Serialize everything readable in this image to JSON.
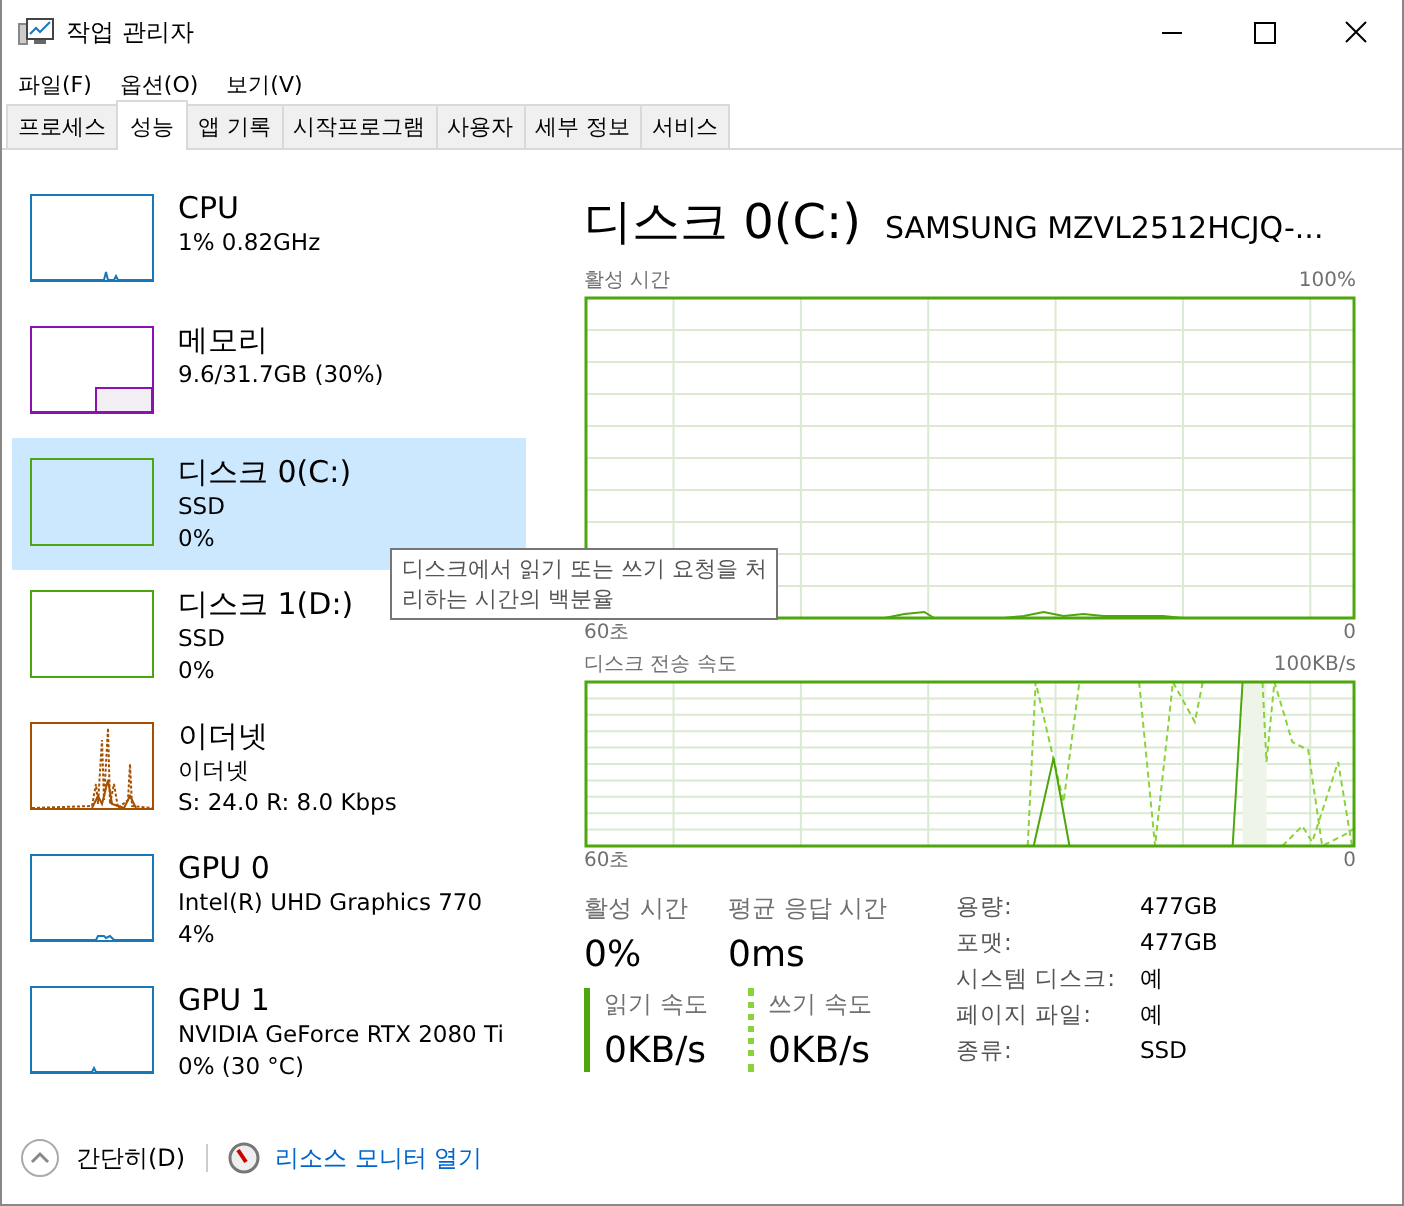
{
  "window": {
    "title": "작업 관리자"
  },
  "menu": [
    "파일(F)",
    "옵션(O)",
    "보기(V)"
  ],
  "tabs": [
    {
      "label": "프로세스",
      "selected": false
    },
    {
      "label": "성능",
      "selected": true
    },
    {
      "label": "앱 기록",
      "selected": false
    },
    {
      "label": "시작프로그램",
      "selected": false
    },
    {
      "label": "사용자",
      "selected": false
    },
    {
      "label": "세부 정보",
      "selected": false
    },
    {
      "label": "서비스",
      "selected": false
    }
  ],
  "sidebar": {
    "items": [
      {
        "kind": "cpu",
        "color": "#1779ba",
        "title": "CPU",
        "lines": [
          "1% 0.82GHz"
        ],
        "selected": false
      },
      {
        "kind": "memory",
        "color": "#8b12ae",
        "title": "메모리",
        "lines": [
          "9.6/31.7GB (30%)"
        ],
        "selected": false
      },
      {
        "kind": "disk",
        "color": "#4da60c",
        "title": "디스크 0(C:)",
        "lines": [
          "SSD",
          "0%"
        ],
        "selected": true
      },
      {
        "kind": "disk",
        "color": "#4da60c",
        "title": "디스크 1(D:)",
        "lines": [
          "SSD",
          "0%"
        ],
        "selected": false
      },
      {
        "kind": "network",
        "color": "#a74f01",
        "title": "이더넷",
        "lines": [
          "이더넷",
          "S: 24.0 R: 8.0 Kbps"
        ],
        "selected": false
      },
      {
        "kind": "gpu",
        "color": "#1779ba",
        "title": "GPU 0",
        "lines": [
          "Intel(R) UHD Graphics 770",
          "4%"
        ],
        "selected": false
      },
      {
        "kind": "gpu1",
        "color": "#1779ba",
        "title": "GPU 1",
        "lines": [
          "NVIDIA GeForce RTX 2080 Ti",
          "0% (30 °C)"
        ],
        "selected": false
      }
    ]
  },
  "tooltip": {
    "lines": [
      "디스크에서 읽기 또는 쓰기 요청을 처",
      "리하는 시간의 백분율"
    ]
  },
  "detail": {
    "title": "디스크 0(C:)",
    "model": "SAMSUNG MZVL2512HCJQ-...",
    "graphs": [
      {
        "kind": "active",
        "label": "활성 시간",
        "max": "100%",
        "time": "60초",
        "min": "0"
      },
      {
        "kind": "transfer",
        "label": "디스크 전송 속도",
        "max": "100KB/s",
        "time": "60초",
        "min": "0"
      }
    ],
    "stats": [
      {
        "label": "활성 시간",
        "value": "0%"
      },
      {
        "label": "평균 응답 시간",
        "value": "0ms"
      }
    ],
    "speeds": [
      {
        "kind": "read",
        "label": "읽기 속도",
        "value": "0KB/s"
      },
      {
        "kind": "write",
        "label": "쓰기 속도",
        "value": "0KB/s"
      }
    ],
    "properties": [
      {
        "label": "용량:",
        "value": "477GB"
      },
      {
        "label": "포맷:",
        "value": "477GB"
      },
      {
        "label": "시스템 디스크:",
        "value": "예"
      },
      {
        "label": "페이지 파일:",
        "value": "예"
      },
      {
        "label": "종류:",
        "value": "SSD"
      }
    ]
  },
  "footer": {
    "collapse": "간단히(D)",
    "link": "리소스 모니터 열기"
  }
}
